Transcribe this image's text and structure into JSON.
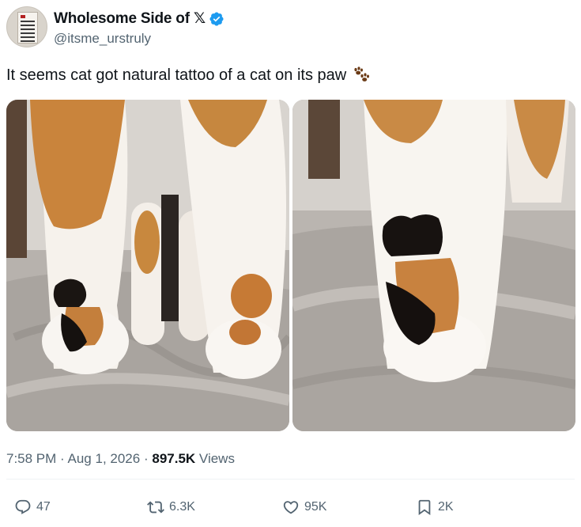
{
  "author": {
    "display_name": "Wholesome Side of 𝕏",
    "handle": "@itsme_urstruly",
    "verified_icon": "verified-badge-icon",
    "badge_color": "#1d9bf0"
  },
  "tweet": {
    "text": "It seems cat got natural tattoo of a cat on its paw",
    "emoji_icon": "paw-prints-icon"
  },
  "media": [
    {
      "icon": "photo-cat-paws-left"
    },
    {
      "icon": "photo-cat-paw-closeup"
    }
  ],
  "meta": {
    "time": "7:58 PM",
    "sep1": "·",
    "date": "Aug 1, 2026",
    "sep2": "·",
    "views_count": "897.5K",
    "views_label": "Views"
  },
  "actions": {
    "reply": {
      "icon": "reply-icon",
      "count": "47"
    },
    "retweet": {
      "icon": "retweet-icon",
      "count": "6.3K"
    },
    "like": {
      "icon": "heart-icon",
      "count": "95K"
    },
    "bookmark": {
      "icon": "bookmark-icon",
      "count": "2K"
    }
  },
  "colors": {
    "text": "#0f1419",
    "secondary": "#536471",
    "accent": "#1d9bf0"
  }
}
